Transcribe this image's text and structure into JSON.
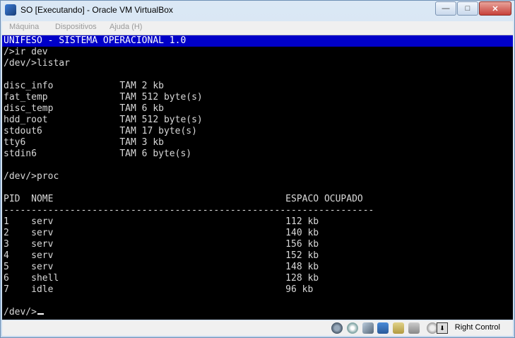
{
  "window": {
    "title": "SO [Executando] - Oracle VM VirtualBox"
  },
  "menu": [
    "Máquina",
    "Dispositivos",
    "Ajuda (H)"
  ],
  "terminal": {
    "banner": "UNIFESO - SISTEMA OPERACIONAL 1.0",
    "lines": [
      "/>ir dev",
      "/dev/>listar",
      "",
      "disc_info            TAM 2 kb",
      "fat_temp             TAM 512 byte(s)",
      "disc_temp            TAM 6 kb",
      "hdd_root             TAM 512 byte(s)",
      "stdout6              TAM 17 byte(s)",
      "tty6                 TAM 3 kb",
      "stdin6               TAM 6 byte(s)",
      "",
      "/dev/>proc",
      "",
      "PID  NOME                                          ESPACO OCUPADO",
      "-------------------------------------------------------------------",
      "1    serv                                          112 kb",
      "2    serv                                          140 kb",
      "3    serv                                          156 kb",
      "4    serv                                          152 kb",
      "5    serv                                          148 kb",
      "6    shell                                         128 kb",
      "7    idle                                          96 kb",
      "",
      "/dev/>"
    ]
  },
  "statusbar": {
    "host_key": "Right Control",
    "icons": [
      "hard-disk-icon",
      "optical-drive-icon",
      "usb-icon",
      "network-icon",
      "shared-folder-icon",
      "display-icon",
      "mouse-integration-icon"
    ]
  },
  "colors": {
    "banner_bg": "#0000c8",
    "terminal_bg": "#000000",
    "terminal_fg": "#d8d8d8"
  }
}
